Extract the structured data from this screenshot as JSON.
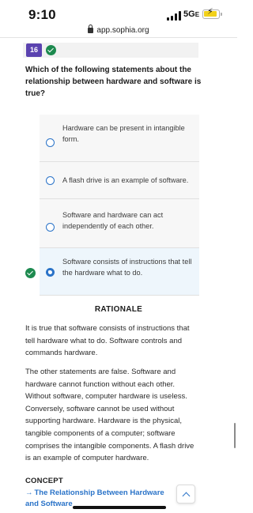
{
  "status_bar": {
    "time": "9:10",
    "network": "5G",
    "network_suffix": "E",
    "battery_icon": "battery-charging-icon",
    "battery_color": "#f2d11a"
  },
  "browser": {
    "url": "app.sophia.org",
    "lock_icon": "lock-icon"
  },
  "question": {
    "number": "16",
    "status_icon": "check-circle-icon",
    "text": "Which of the following statements about the relationship between hardware and software is true?"
  },
  "options": [
    {
      "text": "Hardware can be present in intangible form.",
      "selected": false
    },
    {
      "text": "A flash drive is an example of software.",
      "selected": false
    },
    {
      "text": "Software and hardware can act independently of each other.",
      "selected": false
    },
    {
      "text": "Software consists of instructions that tell the hardware what to do.",
      "selected": true,
      "correct": true
    }
  ],
  "rationale": {
    "title": "RATIONALE",
    "paragraphs": [
      "It is true that software consists of instructions that tell hardware what to do. Software controls and commands hardware.",
      "The other statements are false. Software and hardware cannot function without each other. Without software, computer hardware is useless. Conversely, software cannot be used without supporting hardware. Hardware is the physical, tangible components of a computer; software comprises the intangible components. A flash drive is an example of computer hardware."
    ]
  },
  "concept": {
    "label": "CONCEPT",
    "link_arrow": "→",
    "link_text": "The Relationship Between Hardware and Software"
  },
  "colors": {
    "accent": "#2a73c8",
    "badge": "#5b43b0",
    "correct": "#1d8a4f"
  }
}
